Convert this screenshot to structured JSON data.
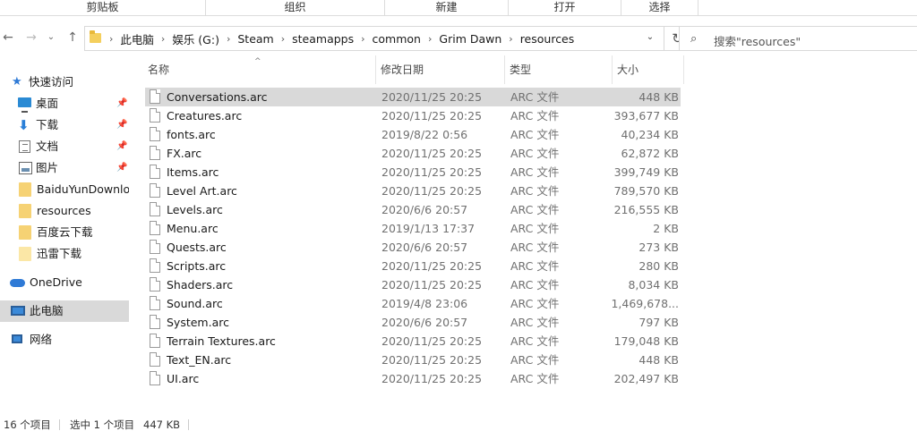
{
  "ribbon": {
    "groups": [
      "剪贴板",
      "组织",
      "新建",
      "打开",
      "选择"
    ]
  },
  "nav_buttons": {
    "back": "←",
    "forward": "→",
    "dropdown": "⌄",
    "up": "↑"
  },
  "address": {
    "breadcrumbs": [
      "此电脑",
      "娱乐 (G:)",
      "Steam",
      "steamapps",
      "common",
      "Grim Dawn",
      "resources"
    ],
    "separator": "›",
    "dropdown": "⌄",
    "refresh": "↻"
  },
  "search": {
    "icon": "⌕",
    "placeholder": "搜索\"resources\""
  },
  "sidebar": {
    "items": [
      {
        "label": "快速访问",
        "icon": "star-icon",
        "pinned": false
      },
      {
        "label": "桌面",
        "icon": "desktop-icon",
        "pinned": true
      },
      {
        "label": "下载",
        "icon": "download-icon",
        "pinned": true
      },
      {
        "label": "文档",
        "icon": "document-icon",
        "pinned": true
      },
      {
        "label": "图片",
        "icon": "pictures-icon",
        "pinned": true
      },
      {
        "label": "BaiduYunDownload",
        "icon": "folder-icon",
        "pinned": false
      },
      {
        "label": "resources",
        "icon": "folder-icon",
        "pinned": false
      },
      {
        "label": "百度云下载",
        "icon": "folder-icon",
        "pinned": false
      },
      {
        "label": "迅雷下载",
        "icon": "folder-icon",
        "pinned": false
      },
      {
        "label": "OneDrive",
        "icon": "cloud-icon",
        "pinned": false
      },
      {
        "label": "此电脑",
        "icon": "computer-icon",
        "pinned": false,
        "selected": true
      },
      {
        "label": "网络",
        "icon": "network-icon",
        "pinned": false
      }
    ],
    "pin_glyph": "📌"
  },
  "columns": {
    "name": "名称",
    "date": "修改日期",
    "type": "类型",
    "size": "大小",
    "sort_glyph": "^"
  },
  "files": [
    {
      "name": "Conversations.arc",
      "date": "2020/11/25 20:25",
      "type": "ARC 文件",
      "size": "448 KB",
      "selected": true
    },
    {
      "name": "Creatures.arc",
      "date": "2020/11/25 20:25",
      "type": "ARC 文件",
      "size": "393,677 KB"
    },
    {
      "name": "fonts.arc",
      "date": "2019/8/22 0:56",
      "type": "ARC 文件",
      "size": "40,234 KB"
    },
    {
      "name": "FX.arc",
      "date": "2020/11/25 20:25",
      "type": "ARC 文件",
      "size": "62,872 KB"
    },
    {
      "name": "Items.arc",
      "date": "2020/11/25 20:25",
      "type": "ARC 文件",
      "size": "399,749 KB"
    },
    {
      "name": "Level Art.arc",
      "date": "2020/11/25 20:25",
      "type": "ARC 文件",
      "size": "789,570 KB"
    },
    {
      "name": "Levels.arc",
      "date": "2020/6/6 20:57",
      "type": "ARC 文件",
      "size": "216,555 KB"
    },
    {
      "name": "Menu.arc",
      "date": "2019/1/13 17:37",
      "type": "ARC 文件",
      "size": "2 KB"
    },
    {
      "name": "Quests.arc",
      "date": "2020/6/6 20:57",
      "type": "ARC 文件",
      "size": "273 KB"
    },
    {
      "name": "Scripts.arc",
      "date": "2020/11/25 20:25",
      "type": "ARC 文件",
      "size": "280 KB"
    },
    {
      "name": "Shaders.arc",
      "date": "2020/11/25 20:25",
      "type": "ARC 文件",
      "size": "8,034 KB"
    },
    {
      "name": "Sound.arc",
      "date": "2019/4/8 23:06",
      "type": "ARC 文件",
      "size": "1,469,678..."
    },
    {
      "name": "System.arc",
      "date": "2020/6/6 20:57",
      "type": "ARC 文件",
      "size": "797 KB"
    },
    {
      "name": "Terrain Textures.arc",
      "date": "2020/11/25 20:25",
      "type": "ARC 文件",
      "size": "179,048 KB"
    },
    {
      "name": "Text_EN.arc",
      "date": "2020/11/25 20:25",
      "type": "ARC 文件",
      "size": "448 KB"
    },
    {
      "name": "UI.arc",
      "date": "2020/11/25 20:25",
      "type": "ARC 文件",
      "size": "202,497 KB"
    }
  ],
  "status": {
    "count": "16 个项目",
    "selected": "选中 1 个项目",
    "selected_size": "447 KB"
  }
}
